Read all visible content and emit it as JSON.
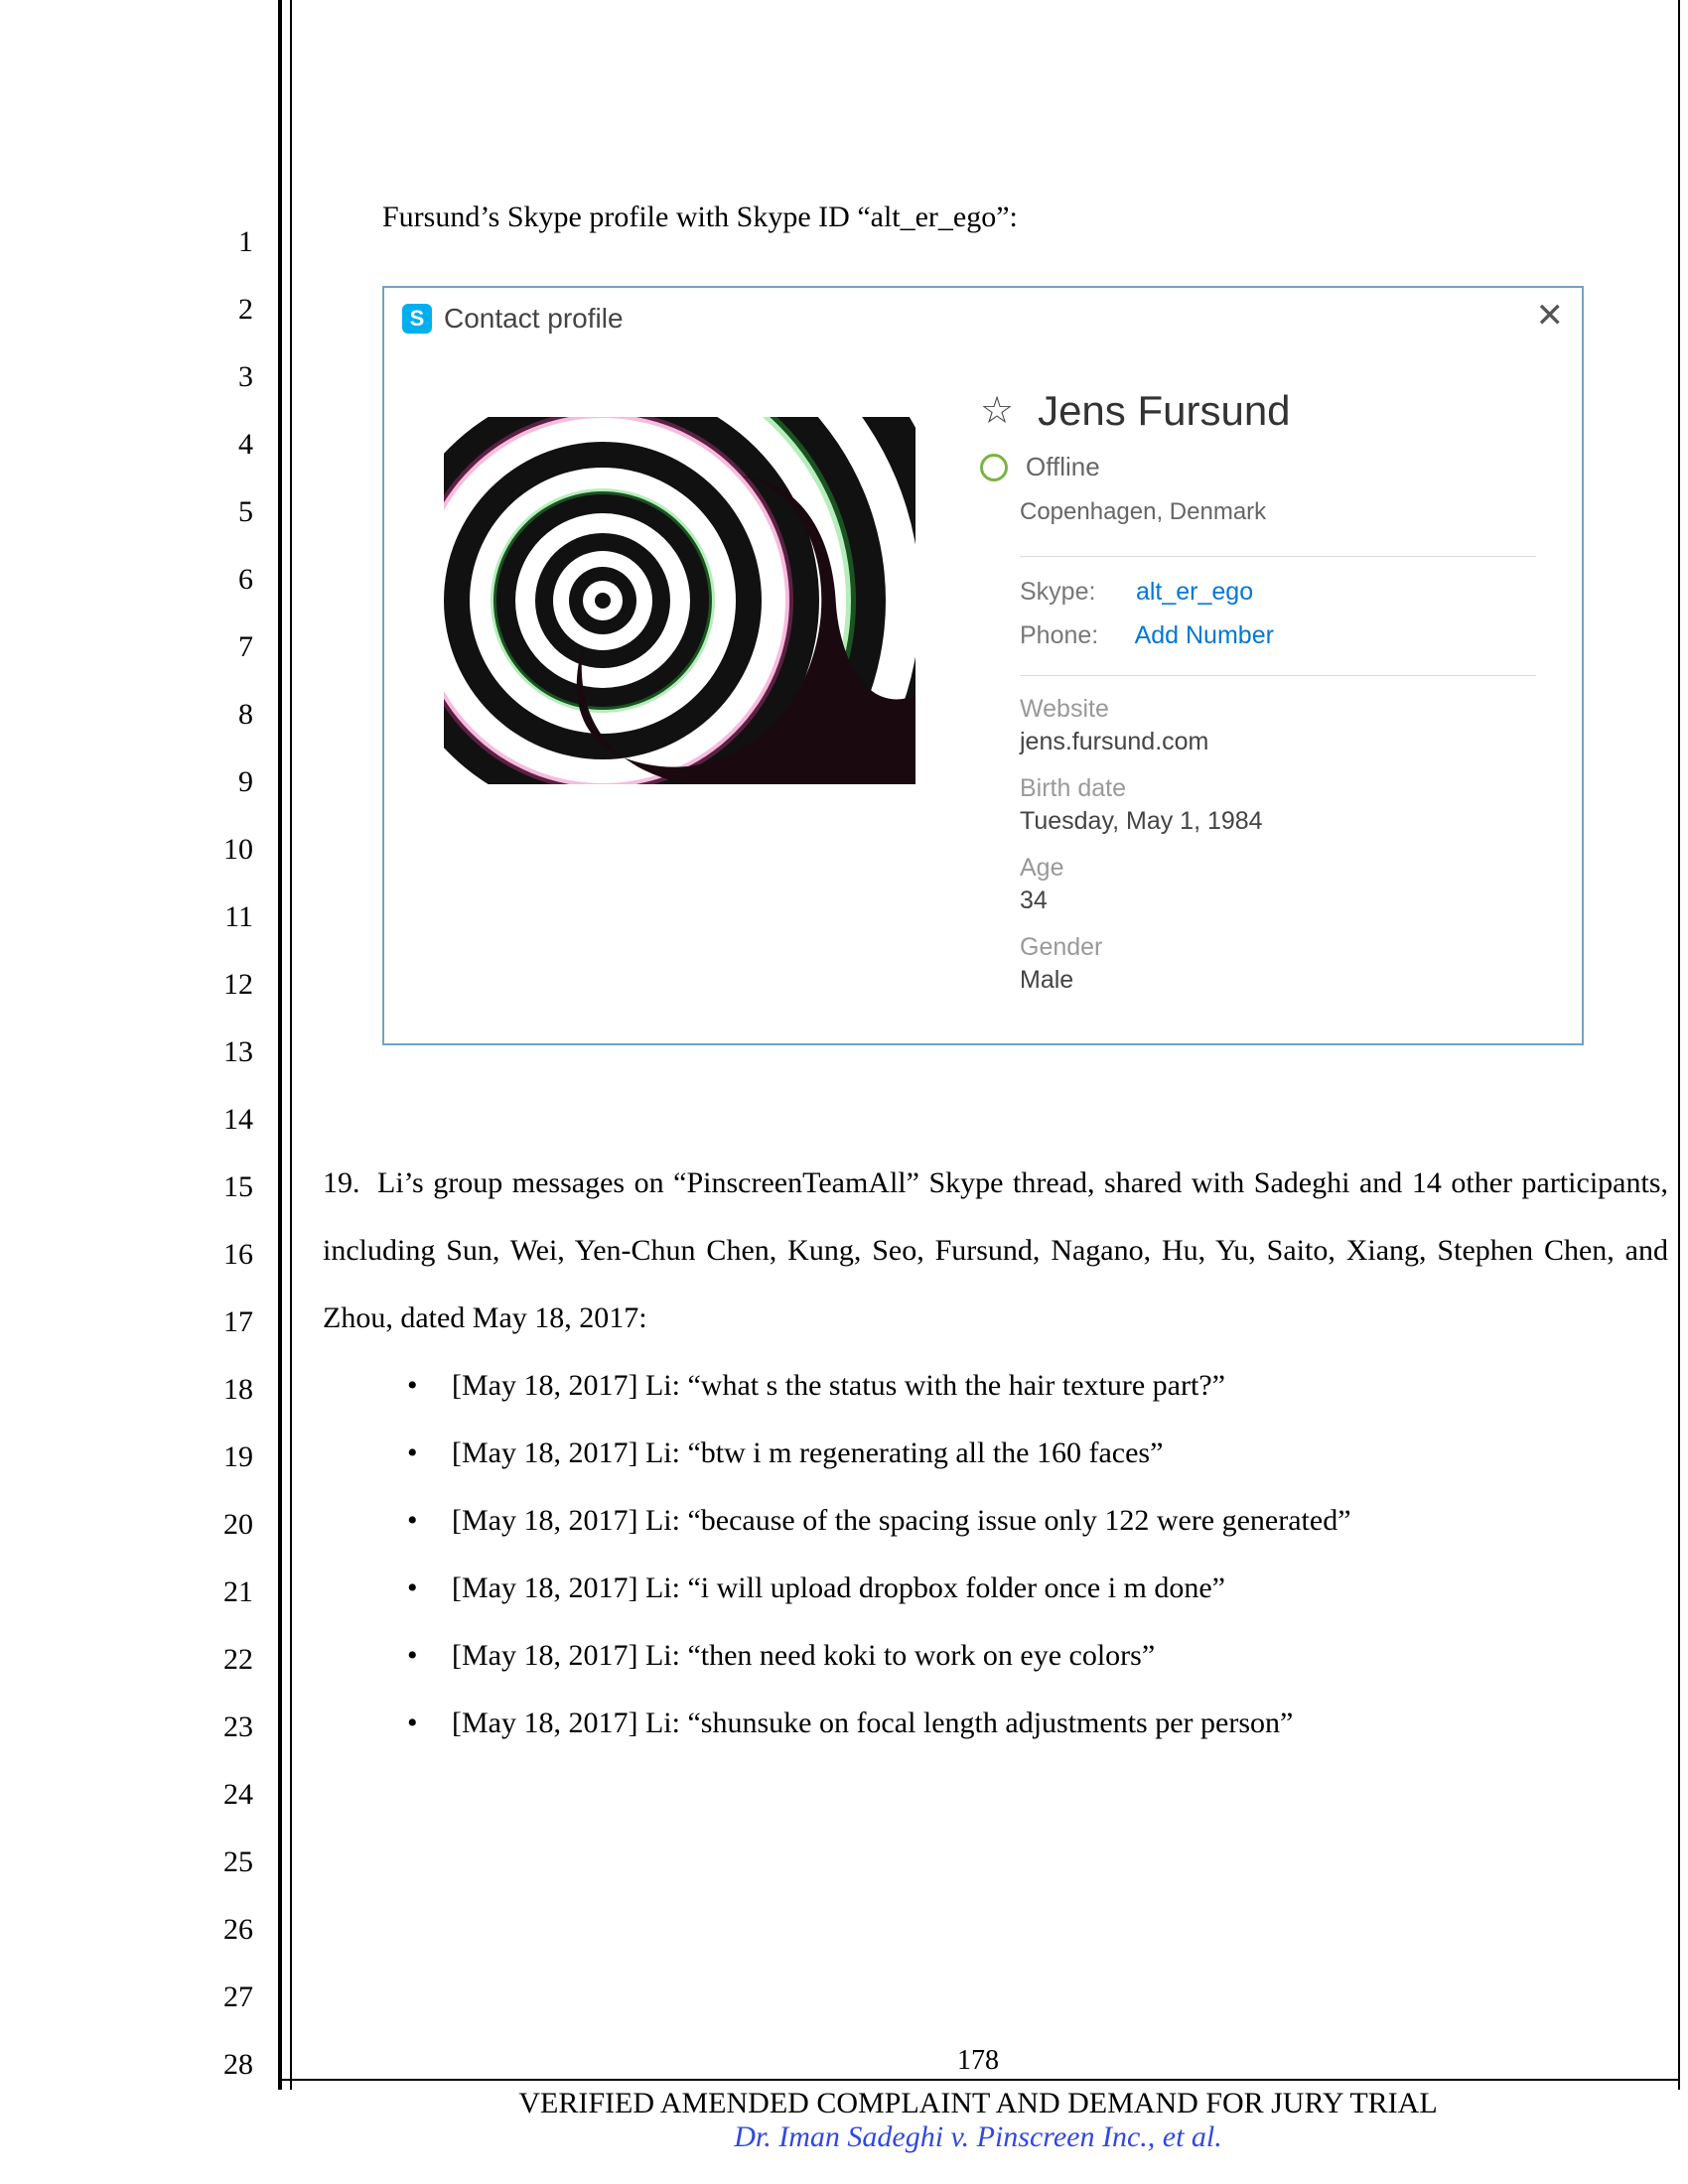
{
  "intro_text": "Fursund’s Skype profile with Skype ID “alt_er_ego”:",
  "line_numbers": [
    "1",
    "2",
    "3",
    "4",
    "5",
    "6",
    "7",
    "8",
    "9",
    "10",
    "11",
    "12",
    "13",
    "14",
    "15",
    "16",
    "17",
    "18",
    "19",
    "20",
    "21",
    "22",
    "23",
    "24",
    "25",
    "26",
    "27",
    "28"
  ],
  "skype": {
    "window_title": "Contact profile",
    "logo_letter": "S",
    "close_glyph": "✕",
    "star_glyph": "☆",
    "name": "Jens Fursund",
    "status": "Offline",
    "location": "Copenhagen, Denmark",
    "skype_label": "Skype:",
    "skype_id": "alt_er_ego",
    "phone_label": "Phone:",
    "phone_value": "Add Number",
    "website_label": "Website",
    "website_value": "jens.fursund.com",
    "birth_label": "Birth date",
    "birth_value": "Tuesday, May 1, 1984",
    "age_label": "Age",
    "age_value": "34",
    "gender_label": "Gender",
    "gender_value": "Male"
  },
  "para19": {
    "number": "19.",
    "lead": "Li’s group messages on “PinscreenTeamAll” Skype thread, shared with Sadeghi and 14 other participants, including Sun, Wei, Yen-Chun Chen, Kung, Seo, Fursund, Nagano, Hu, Yu, Saito, Xiang, Stephen Chen, and Zhou, dated May 18, 2017:",
    "bullets": [
      "[May 18, 2017] Li: “what s the status with the hair texture part?”",
      "[May 18, 2017] Li: “btw i m regenerating all the 160 faces”",
      "[May 18, 2017] Li: “because of the spacing issue only 122 were generated”",
      "[May 18, 2017] Li: “i will upload dropbox folder once i m done”",
      "[May 18, 2017] Li: “then need koki to work on eye colors”",
      "[May 18, 2017] Li: “shunsuke on focal length adjustments per person”"
    ]
  },
  "footer": {
    "page_number": "178",
    "caption": "VERIFIED AMENDED COMPLAINT AND DEMAND FOR JURY TRIAL",
    "parties": "Dr. Iman Sadeghi v. Pinscreen Inc., et al."
  }
}
